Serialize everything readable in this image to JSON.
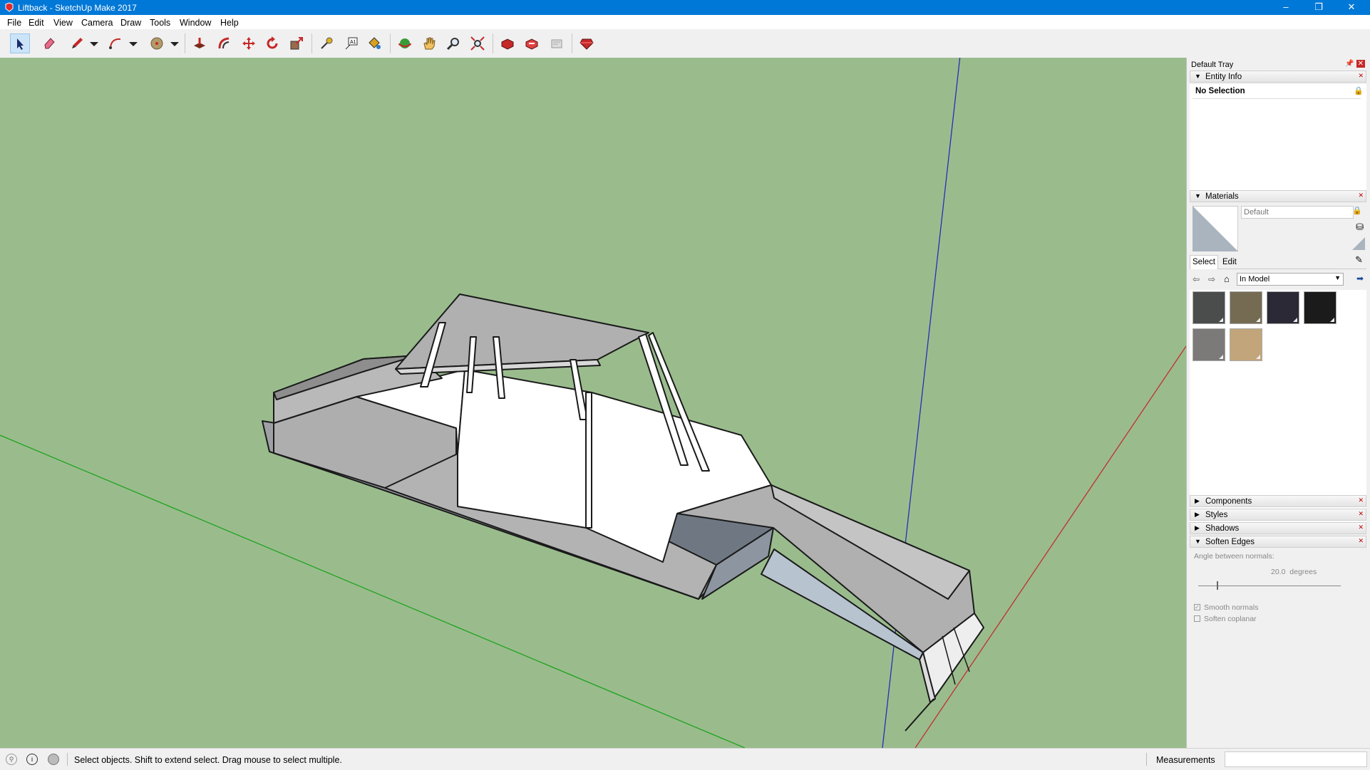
{
  "window": {
    "title": "Liftback - SketchUp Make 2017",
    "controls": [
      "–",
      "❐",
      "✕"
    ]
  },
  "menu": [
    "File",
    "Edit",
    "View",
    "Camera",
    "Draw",
    "Tools",
    "Window",
    "Help"
  ],
  "toolbar": [
    "select-arrow-icon",
    "eraser-icon",
    "pencil-icon",
    "dropdown-arrow-icon",
    "arc-icon",
    "dropdown-arrow-icon",
    "circle-icon",
    "dropdown-arrow-icon",
    "push-pull-icon",
    "offset-icon",
    "move-icon",
    "rotate-icon",
    "scale-icon",
    "tape-measure-icon",
    "text-icon",
    "paint-bucket-icon",
    "orbit-icon",
    "pan-hand-icon",
    "zoom-icon",
    "zoom-extents-icon",
    "warehouse-icon",
    "extension-warehouse-icon",
    "send-to-layout-icon",
    "ruby-icon"
  ],
  "tray": {
    "title": "Default Tray",
    "entity_info": {
      "label": "Entity Info",
      "selection": "No Selection"
    },
    "materials": {
      "label": "Materials",
      "name_placeholder": "Default",
      "tabs": [
        "Select",
        "Edit"
      ],
      "collection": "In Model",
      "swatches": [
        "#4a4d4b",
        "#756b52",
        "#2a2935",
        "#1b1b1b",
        "#7c7979",
        "#c2a57a"
      ]
    },
    "collapsed_panels": [
      "Components",
      "Styles",
      "Shadows"
    ],
    "soften_edges": {
      "label": "Soften Edges",
      "angle_label": "Angle between normals:",
      "angle_value": "20.0  degrees",
      "smooth_normals": "Smooth normals",
      "soften_coplanar": "Soften coplanar"
    }
  },
  "status": {
    "message": "Select objects. Shift to extend select. Drag mouse to select multiple.",
    "measurements_label": "Measurements"
  },
  "colors": {
    "titlebar": "#0078d7",
    "viewport": "#9abc8d"
  }
}
